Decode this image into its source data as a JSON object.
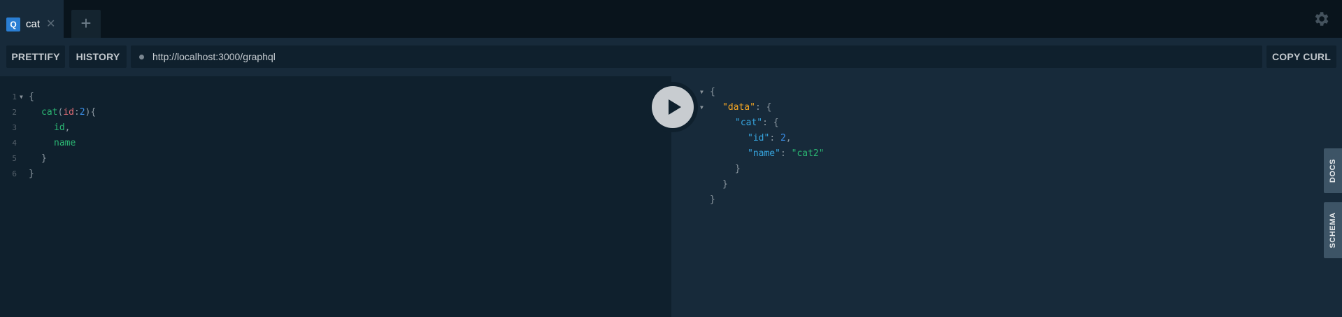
{
  "tabs": [
    {
      "badge": "Q",
      "title": "cat",
      "close": "✕"
    }
  ],
  "new_tab_label": "+",
  "toolbar": {
    "prettify_label": "PRETTIFY",
    "history_label": "HISTORY",
    "endpoint": "http://localhost:3000/graphql",
    "copy_curl_label": "COPY CURL"
  },
  "query_editor": {
    "line_numbers": [
      "1",
      "2",
      "3",
      "4",
      "5",
      "6"
    ],
    "lines": [
      {
        "open": "{"
      },
      {
        "field": "cat",
        "paren_open": "(",
        "arg": "id",
        "colon": ":",
        "value": "2",
        "paren_close": ")",
        "brace": "{"
      },
      {
        "field": "id",
        "comma": ","
      },
      {
        "field": "name"
      },
      {
        "brace": "}"
      },
      {
        "brace": "}"
      }
    ]
  },
  "result": {
    "open_brace": "{",
    "data_key": "\"data\"",
    "cat_key": "\"cat\"",
    "id_key": "\"id\"",
    "id_value": "2",
    "name_key": "\"name\"",
    "name_value": "\"cat2\"",
    "colon_brace": ": {",
    "colon": ": ",
    "comma": ",",
    "close_brace": "}"
  },
  "side_tabs": {
    "docs_label": "DOCS",
    "schema_label": "SCHEMA"
  },
  "icons": {
    "settings": "gear-icon",
    "run": "play-icon",
    "fold": "caret-down-icon"
  },
  "colors": {
    "accent": "#2a7ed3",
    "background": "#0f202d",
    "panel": "#172a3a"
  }
}
